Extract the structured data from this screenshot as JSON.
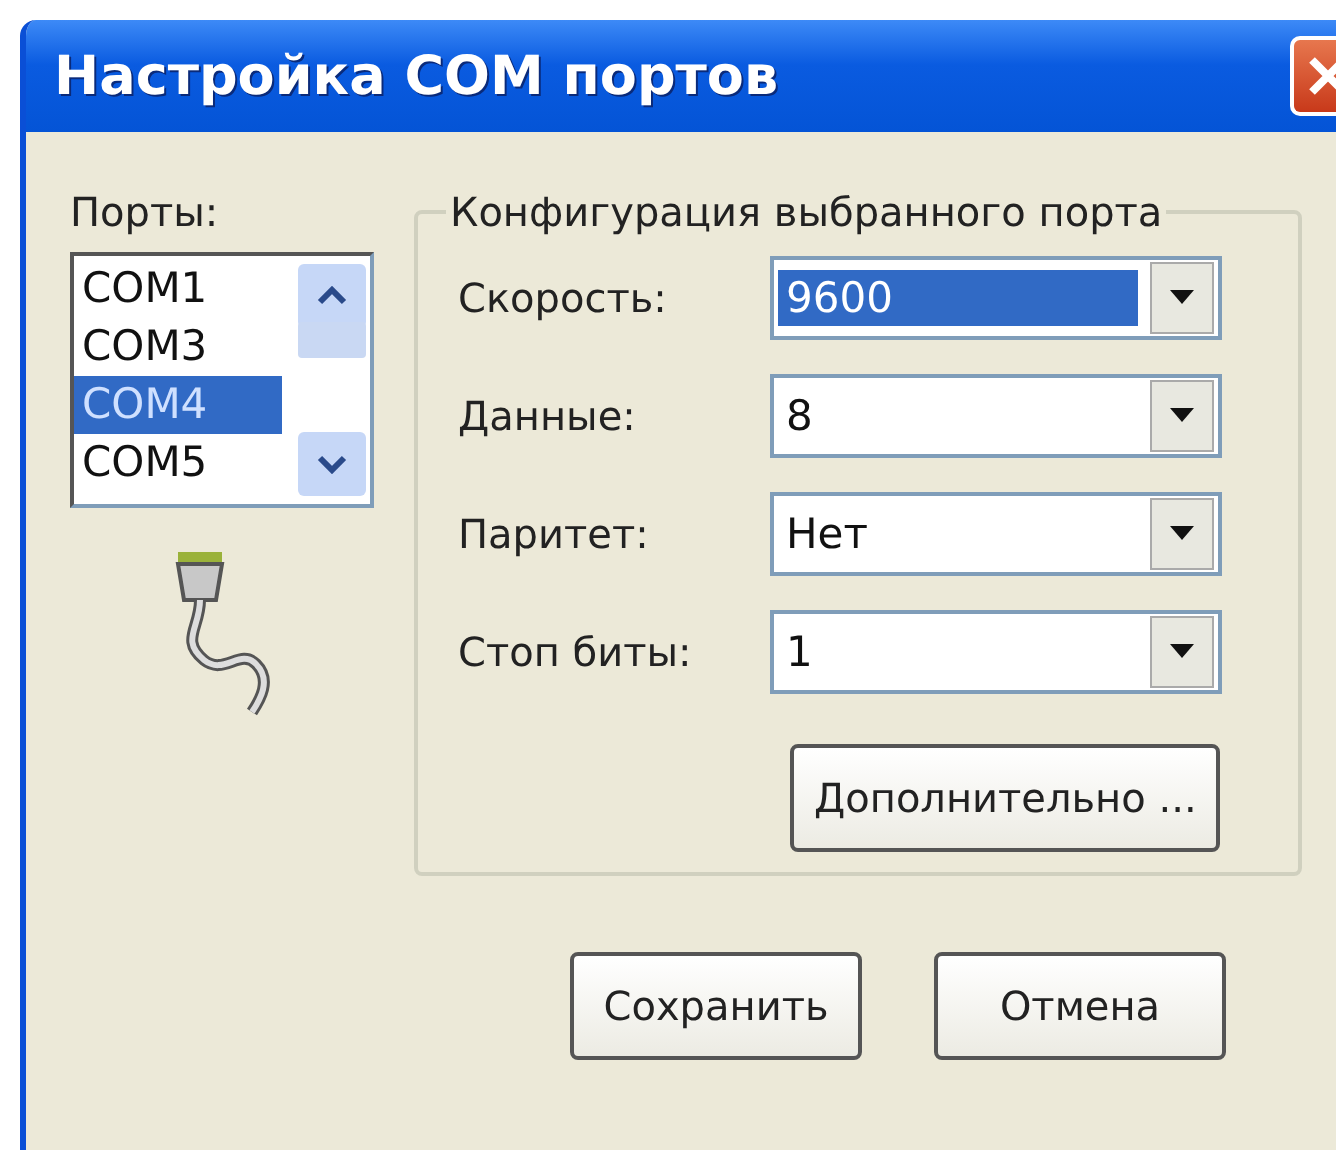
{
  "window": {
    "title": "Настройка COM портов"
  },
  "ports": {
    "label": "Порты:",
    "items": [
      {
        "name": "COM1",
        "selected": false
      },
      {
        "name": "COM3",
        "selected": false
      },
      {
        "name": "COM4",
        "selected": true
      },
      {
        "name": "COM5",
        "selected": false
      }
    ]
  },
  "config": {
    "title": "Конфигурация выбранного порта",
    "fields": [
      {
        "label": "Скорость:",
        "value": "9600",
        "focused": true
      },
      {
        "label": "Данные:",
        "value": "8",
        "focused": false
      },
      {
        "label": "Паритет:",
        "value": "Нет",
        "focused": false
      },
      {
        "label": "Стоп биты:",
        "value": "1",
        "focused": false
      }
    ],
    "advanced_button": "Дополнительно ..."
  },
  "buttons": [
    "Сохранить",
    "Отмена"
  ]
}
